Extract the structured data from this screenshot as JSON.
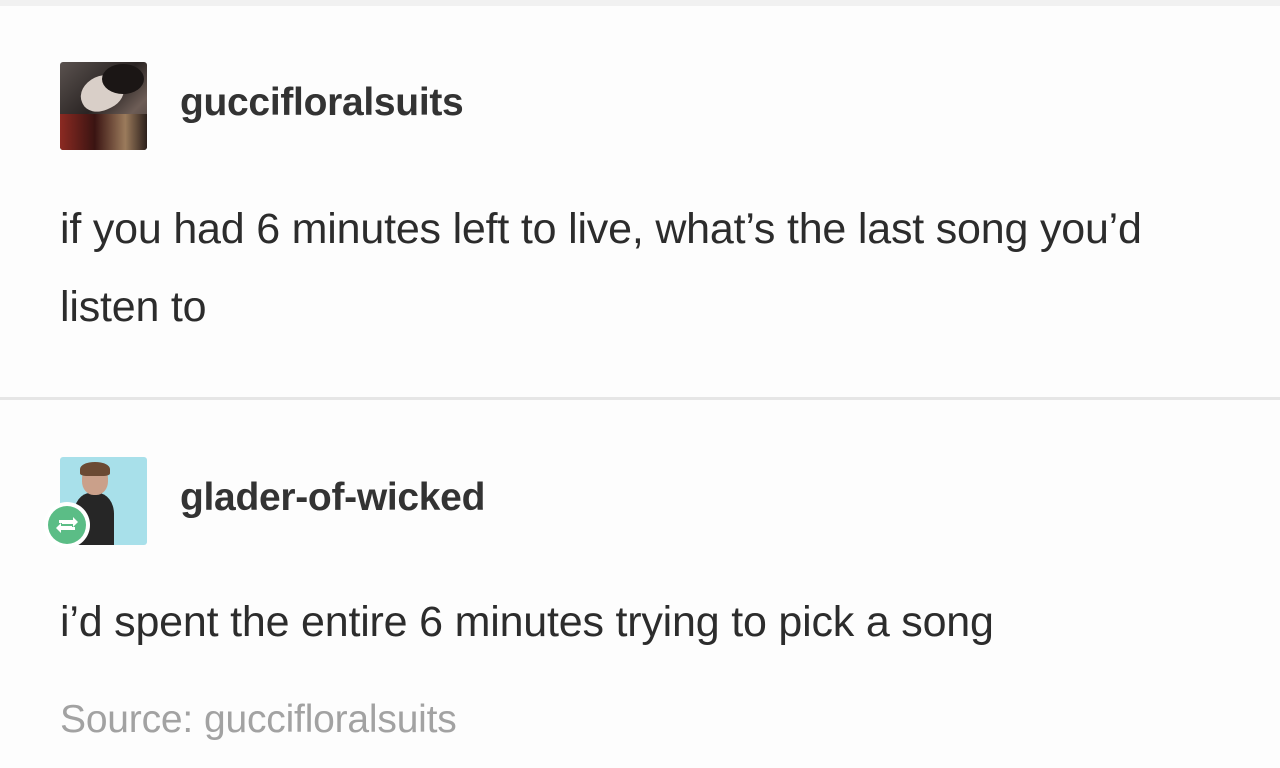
{
  "post_original": {
    "username": "guccifloralsuits",
    "text": "if you had 6 minutes left to live, what’s the last song you’d listen to"
  },
  "post_reblog": {
    "username": "glader-of-wicked",
    "text": "i’d spent the entire 6 minutes trying to pick a song",
    "badge_icon": "reblog-icon"
  },
  "footer": {
    "source_label": "Source:",
    "source_name": "guccifloralsuits"
  },
  "colors": {
    "text": "#2c2c2c",
    "username": "#333333",
    "source": "#a2a2a2",
    "reblog_badge": "#5bbd86"
  }
}
